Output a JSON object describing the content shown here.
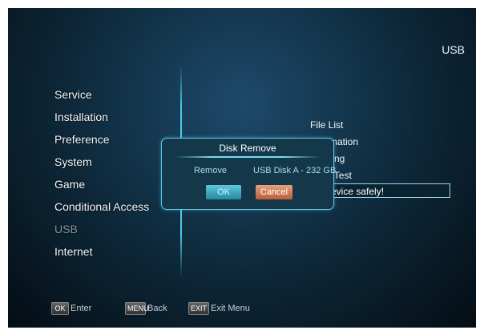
{
  "screen": {
    "title": "USB"
  },
  "menu": {
    "items": [
      {
        "label": "Service"
      },
      {
        "label": "Installation"
      },
      {
        "label": "Preference"
      },
      {
        "label": "System"
      },
      {
        "label": "Game"
      },
      {
        "label": "Conditional Access"
      },
      {
        "label": "USB"
      },
      {
        "label": "Internet"
      }
    ]
  },
  "usb_options": {
    "items": [
      {
        "label": "File List"
      },
      {
        "label": "rmation"
      },
      {
        "label": "rting"
      },
      {
        "label": "d Test"
      }
    ],
    "message": "evice safely!"
  },
  "dialog": {
    "title": "Disk Remove",
    "remove_label": "Remove",
    "device": "USB Disk A - 232 GB",
    "ok_label": "OK",
    "cancel_label": "Cancel"
  },
  "footer": {
    "ok_key": "OK",
    "ok_text": "Enter",
    "menu_key": "MENU",
    "menu_text": "Back",
    "exit_key": "EXIT",
    "exit_text": "Exit Menu"
  }
}
